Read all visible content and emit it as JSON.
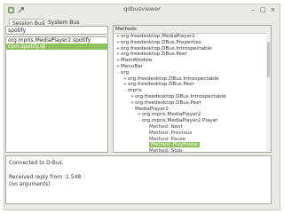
{
  "window": {
    "title": "qdbusviewer",
    "controls": [
      "–",
      "□",
      "×"
    ]
  },
  "tabs": [
    "Session Bus",
    "System Bus"
  ],
  "search": {
    "value": "spotify",
    "placeholder": ""
  },
  "services": [
    {
      "label": "org.mpris.MediaPlayer2.spotify",
      "selected": false
    },
    {
      "label": "com.spotify.qt",
      "selected": true
    }
  ],
  "tree": {
    "header": "Methods",
    "nodes": [
      {
        "depth": 0,
        "exp": "+",
        "label": "org.freedesktop.MediaPlayer2"
      },
      {
        "depth": 0,
        "exp": "+",
        "label": "org.freedesktop.DBus.Properties"
      },
      {
        "depth": 0,
        "exp": "+",
        "label": "org.freedesktop.DBus.Introspectable"
      },
      {
        "depth": 0,
        "exp": "+",
        "label": "org.freedesktop.DBus.Peer"
      },
      {
        "depth": 0,
        "exp": "+",
        "label": "MainWindow"
      },
      {
        "depth": 0,
        "exp": "+",
        "label": "MenuBar"
      },
      {
        "depth": 0,
        "exp": "-",
        "label": "org"
      },
      {
        "depth": 1,
        "exp": "+",
        "label": "org.freedesktop.DBus.Introspectable"
      },
      {
        "depth": 1,
        "exp": "+",
        "label": "org.freedesktop.DBus.Peer"
      },
      {
        "depth": 1,
        "exp": "-",
        "label": "mpris"
      },
      {
        "depth": 2,
        "exp": "+",
        "label": "org.freedesktop.DBus.Introspectable"
      },
      {
        "depth": 2,
        "exp": "+",
        "label": "org.freedesktop.DBus.Peer"
      },
      {
        "depth": 2,
        "exp": "-",
        "label": "MediaPlayer2"
      },
      {
        "depth": 3,
        "exp": "+",
        "label": "org.mpris.MediaPlayer2"
      },
      {
        "depth": 3,
        "exp": "-",
        "label": "org.mpris.MediaPlayer2.Player"
      },
      {
        "depth": 4,
        "exp": "",
        "label": "Method: Next"
      },
      {
        "depth": 4,
        "exp": "",
        "label": "Method: Previous"
      },
      {
        "depth": 4,
        "exp": "",
        "label": "Method: Pause"
      },
      {
        "depth": 4,
        "exp": "",
        "label": "Method: PlayPause",
        "selected": true
      },
      {
        "depth": 4,
        "exp": "",
        "label": "Method: Stop"
      },
      {
        "depth": 4,
        "exp": "",
        "label": "Method: Play"
      },
      {
        "depth": 4,
        "exp": "",
        "label": "Method: Seek"
      }
    ]
  },
  "log": {
    "lines": [
      "Connected to D-Bus.",
      "",
      "Received reply from :1.548",
      "  (no arguments)"
    ]
  },
  "colors": {
    "selection": "#8fc15e",
    "window_bg": "#e9eae6"
  }
}
